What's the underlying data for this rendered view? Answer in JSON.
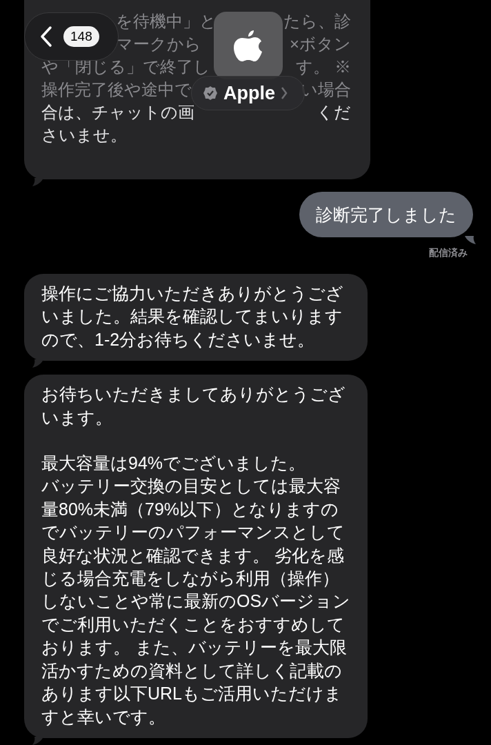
{
  "header": {
    "back_count": "148",
    "contact_name": "Apple",
    "verified": true
  },
  "messages": [
    {
      "kind": "incoming_fragments",
      "lines": [
        {
          "after_back": "を待機中」と",
          "end": "たら、診"
        },
        {
          "after_back": "マークから",
          "end": "×ボタン"
        },
        {
          "start": "や「閉じる」で終了し",
          "end": "す。 ※"
        },
        {
          "start": "操作完了後や途中で",
          "end": "い場合"
        },
        {
          "start": "合は、チャットの画",
          "end": "くだ"
        },
        {
          "start": "さいませ。"
        }
      ]
    },
    {
      "kind": "outgoing",
      "text": "診断完了しました",
      "status": "配信済み"
    },
    {
      "kind": "incoming",
      "text": "操作にご協力いただきありがとうございました。結果を確認してまいりますので、1-2分お待ちくださいませ。"
    },
    {
      "kind": "incoming_blocks",
      "blocks": [
        [
          "お待ちいただきましてありがとうございます。"
        ],
        [
          "最大容量は94%でございました。",
          "バッテリー交換の目安としては最大容量80%未満（79%以下）となりますのでバッテリーのパフォーマンスとして良好な状況と確認できます。 劣化を感じる場合充電をしながら利用（操作）しないことや常に最新のOSバージョンでご利用いただくことをおすすめしております。 また、バッテリーを最大限活かすための資料として詳しく記載のあります以下URLもご活用いただけますと幸いです。"
        ]
      ]
    }
  ]
}
